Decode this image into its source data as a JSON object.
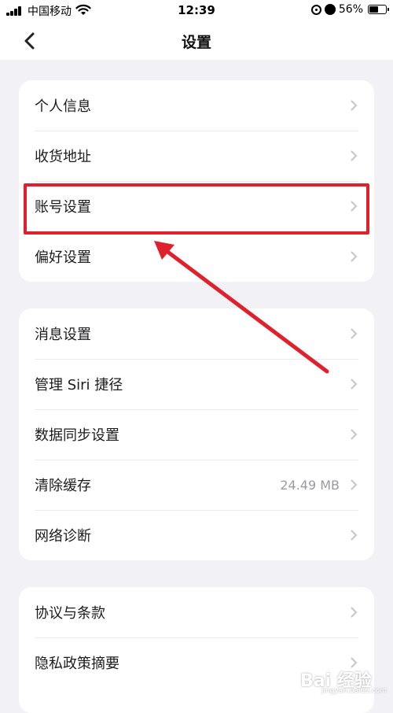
{
  "status_bar": {
    "carrier": "中国移动",
    "time": "12:39",
    "battery": "56%",
    "battery_level": 0.56
  },
  "nav": {
    "title": "设置"
  },
  "groups": [
    {
      "items": [
        {
          "label": "个人信息"
        },
        {
          "label": "收货地址"
        },
        {
          "label": "账号设置"
        },
        {
          "label": "偏好设置"
        }
      ]
    },
    {
      "items": [
        {
          "label": "消息设置"
        },
        {
          "label": "管理 Siri 捷径"
        },
        {
          "label": "数据同步设置"
        },
        {
          "label": "清除缓存",
          "value": "24.49 MB"
        },
        {
          "label": "网络诊断"
        }
      ]
    },
    {
      "items": [
        {
          "label": "协议与条款"
        },
        {
          "label": "隐私政策摘要"
        }
      ]
    }
  ],
  "annotation": {
    "highlight_color": "#e0202c"
  },
  "watermark": {
    "text": "Bai 经验",
    "url": "jingyan.baidu.com"
  },
  "icons": [
    "signal-icon",
    "wifi-icon",
    "rotation-lock-icon",
    "alarm-icon",
    "battery-icon",
    "back-chevron-icon",
    "chevron-right-icon"
  ]
}
